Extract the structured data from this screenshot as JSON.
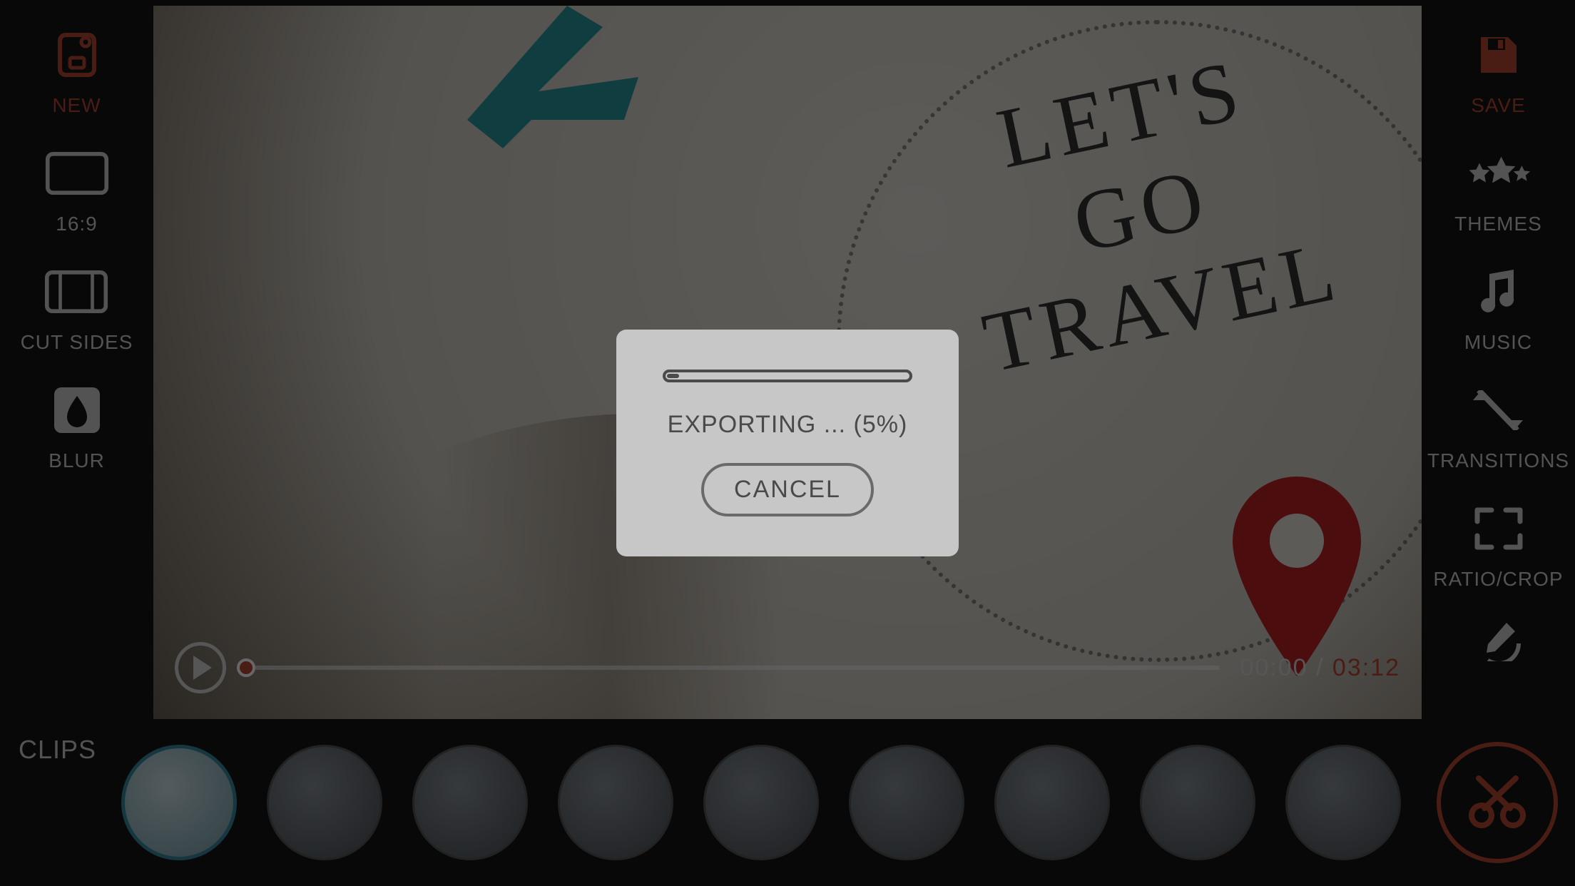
{
  "left_sidebar": {
    "new": {
      "label": "NEW",
      "icon": "new-document-icon",
      "active": true
    },
    "aspect": {
      "label": "16:9",
      "icon": "aspect-16-9-icon"
    },
    "cutsides": {
      "label": "CUT SIDES",
      "icon": "cut-sides-icon"
    },
    "blur": {
      "label": "BLUR",
      "icon": "blur-drop-icon"
    }
  },
  "right_sidebar": {
    "save": {
      "label": "SAVE",
      "icon": "save-icon",
      "active": true
    },
    "themes": {
      "label": "THEMES",
      "icon": "stars-icon"
    },
    "music": {
      "label": "MUSIC",
      "icon": "music-note-icon"
    },
    "transitions": {
      "label": "TRANSITIONS",
      "icon": "transitions-icon"
    },
    "ratiocrop": {
      "label": "RATIO/CROP",
      "icon": "crop-icon"
    },
    "draw": {
      "label": "",
      "icon": "draw-pencil-icon"
    }
  },
  "preview": {
    "main_text_l1": "LET'S",
    "main_text_l2": "GO",
    "main_text_l3": "TRAVEL"
  },
  "playback": {
    "current": "00:00",
    "separator": "/",
    "total": "03:12"
  },
  "clips": {
    "label": "CLIPS",
    "count": 9,
    "selected_index": 0
  },
  "edit_button": {
    "icon": "scissors-icon"
  },
  "dialog": {
    "message_prefix": "EXPORTING ... (",
    "percent": 5,
    "message_suffix": "%)",
    "cancel_label": "CANCEL"
  },
  "colors": {
    "accent": "#b94a32",
    "text": "#d0d0d0",
    "bg": "#141414"
  }
}
